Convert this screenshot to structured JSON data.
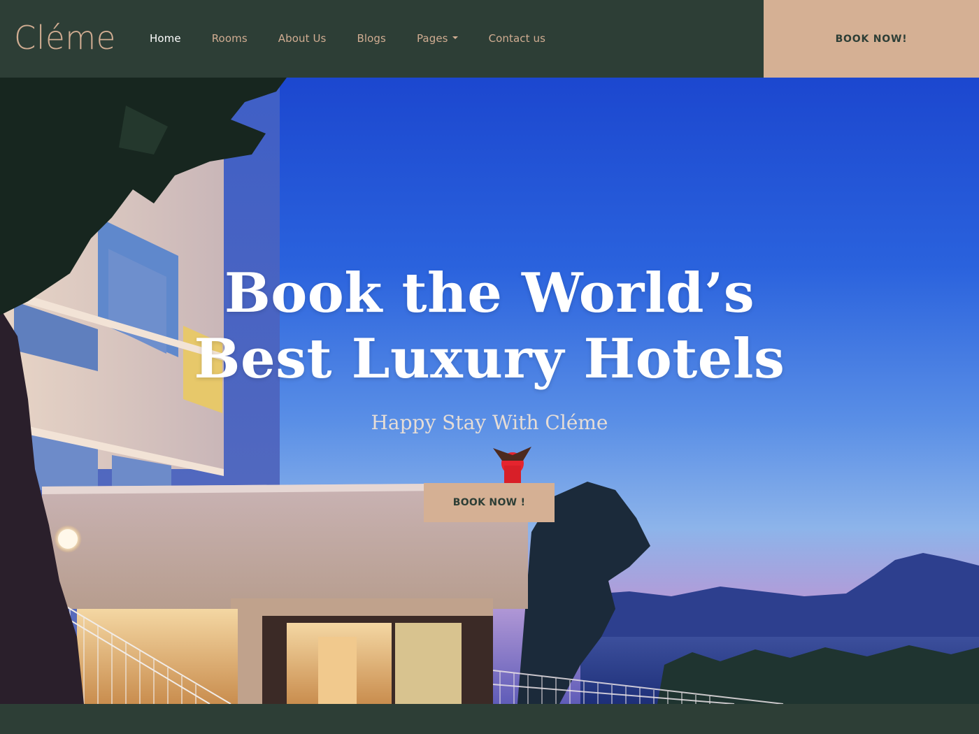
{
  "brand": {
    "name": "Cléme"
  },
  "nav": {
    "items": [
      {
        "label": "Home",
        "active": true
      },
      {
        "label": "Rooms"
      },
      {
        "label": "About Us"
      },
      {
        "label": "Blogs"
      },
      {
        "label": "Pages",
        "has_dropdown": true
      },
      {
        "label": "Contact us"
      }
    ]
  },
  "header": {
    "book_label": "BOOK NOW!"
  },
  "hero": {
    "title_line1": "Book the World’s",
    "title_line2": "Best Luxury Hotels",
    "subtitle": "Happy Stay With Cléme",
    "book_label": "BOOK NOW !"
  },
  "colors": {
    "header_bg": "#2d3e36",
    "accent": "#d5b094",
    "nav_text": "#d1ad92",
    "nav_active": "#ffffff"
  }
}
